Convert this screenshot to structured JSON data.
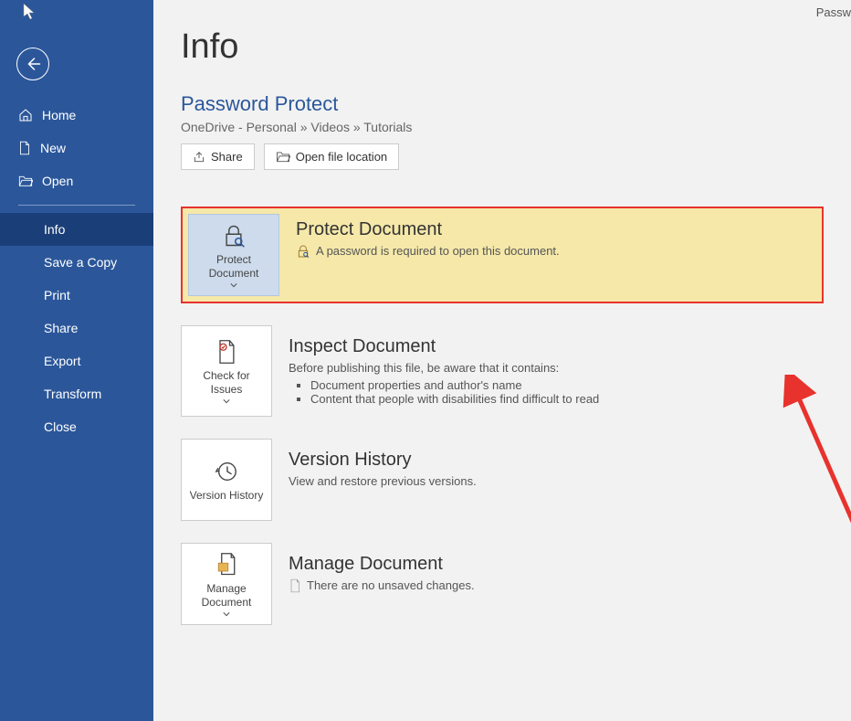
{
  "topright": "Passw",
  "sidebar": {
    "items": [
      {
        "label": "Home",
        "icon": "home"
      },
      {
        "label": "New",
        "icon": "new"
      },
      {
        "label": "Open",
        "icon": "open"
      }
    ],
    "items2": [
      {
        "label": "Info",
        "active": true
      },
      {
        "label": "Save a Copy"
      },
      {
        "label": "Print"
      },
      {
        "label": "Share"
      },
      {
        "label": "Export"
      },
      {
        "label": "Transform"
      },
      {
        "label": "Close"
      }
    ]
  },
  "page": {
    "heading": "Info",
    "docTitle": "Password Protect",
    "breadcrumb": "OneDrive - Personal » Videos » Tutorials",
    "shareLabel": "Share",
    "openLocLabel": "Open file location"
  },
  "protect": {
    "tile": "Protect Document",
    "title": "Protect Document",
    "desc": "A password is required to open this document."
  },
  "inspect": {
    "tile": "Check for Issues",
    "title": "Inspect Document",
    "lead": "Before publishing this file, be aware that it contains:",
    "b1": "Document properties and author's name",
    "b2": "Content that people with disabilities find difficult to read"
  },
  "version": {
    "tile": "Version History",
    "title": "Version History",
    "desc": "View and restore previous versions."
  },
  "manage": {
    "tile": "Manage Document",
    "title": "Manage Document",
    "desc": "There are no unsaved changes."
  }
}
